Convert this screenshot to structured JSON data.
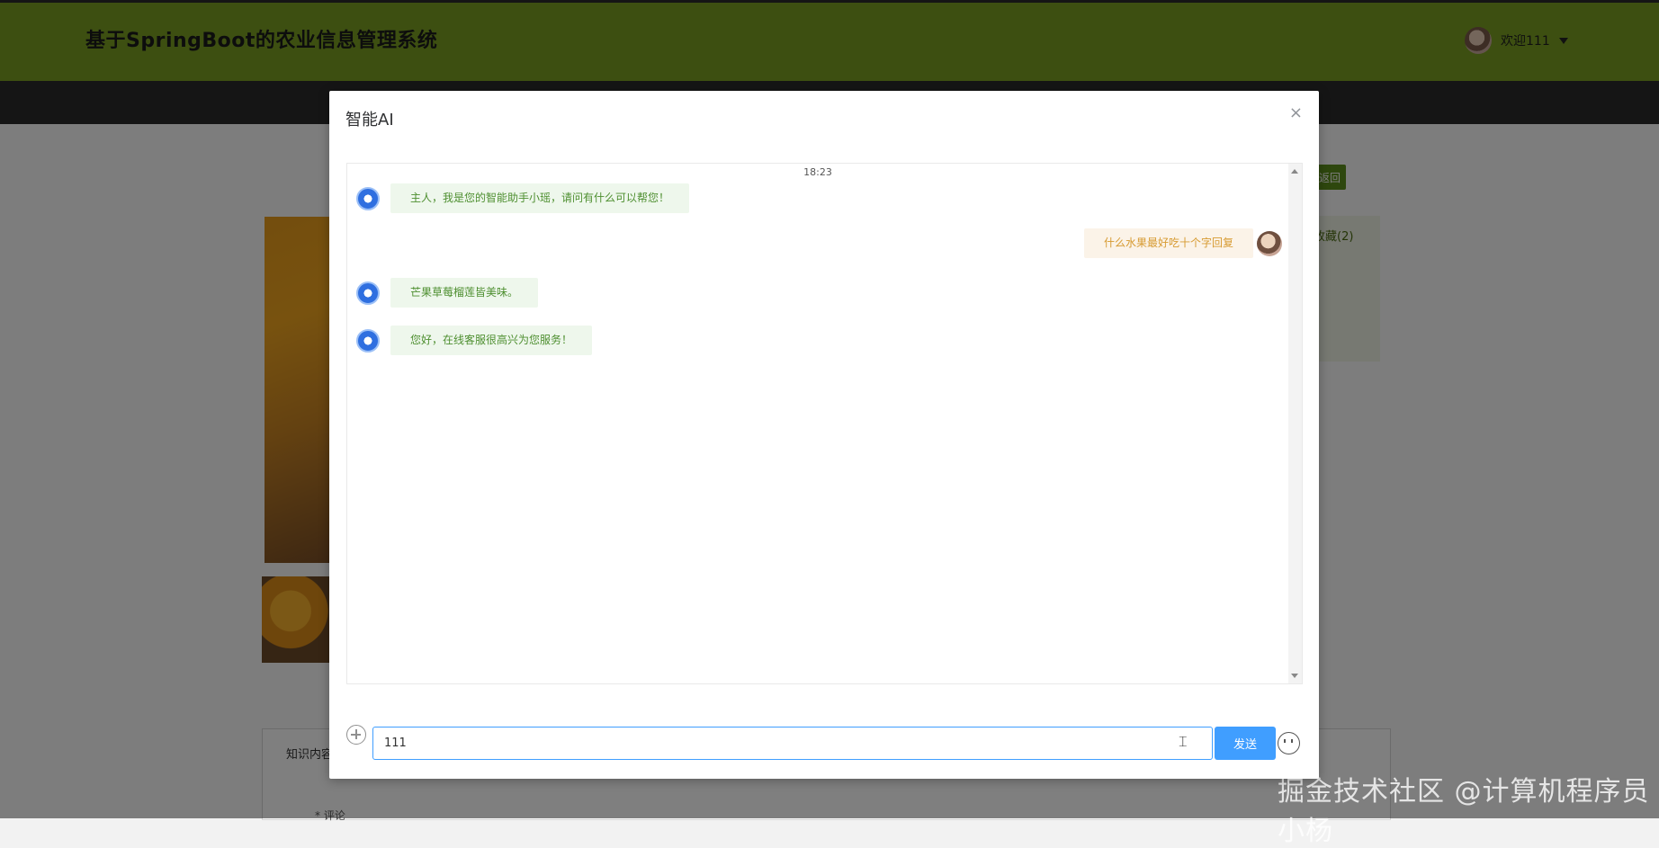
{
  "app": {
    "title": "基于SpringBoot的农业信息管理系统",
    "welcome": "欢迎111"
  },
  "page": {
    "back_label": "返回",
    "fav_label": "收藏(2)",
    "tab_label": "知识内容",
    "comment_label": "* 评论"
  },
  "dialog": {
    "title": "智能AI",
    "close": "×",
    "time": "18:23",
    "messages": [
      {
        "side": "left",
        "text": "主人，我是您的智能助手小瑶，请问有什么可以帮您！"
      },
      {
        "side": "right",
        "text": "什么水果最好吃十个字回复"
      },
      {
        "side": "left",
        "text": "芒果草莓榴莲皆美味。"
      },
      {
        "side": "left",
        "text": "您好，在线客服很高兴为您服务！"
      }
    ],
    "input_value": "111",
    "send_label": "发送"
  },
  "watermark": "掘金技术社区 @计算机程序员小杨",
  "colors": {
    "header": "#7a9f23",
    "primary": "#409eff",
    "bot_bubble": "#eef7ec",
    "user_bubble": "#fbf3e8"
  }
}
